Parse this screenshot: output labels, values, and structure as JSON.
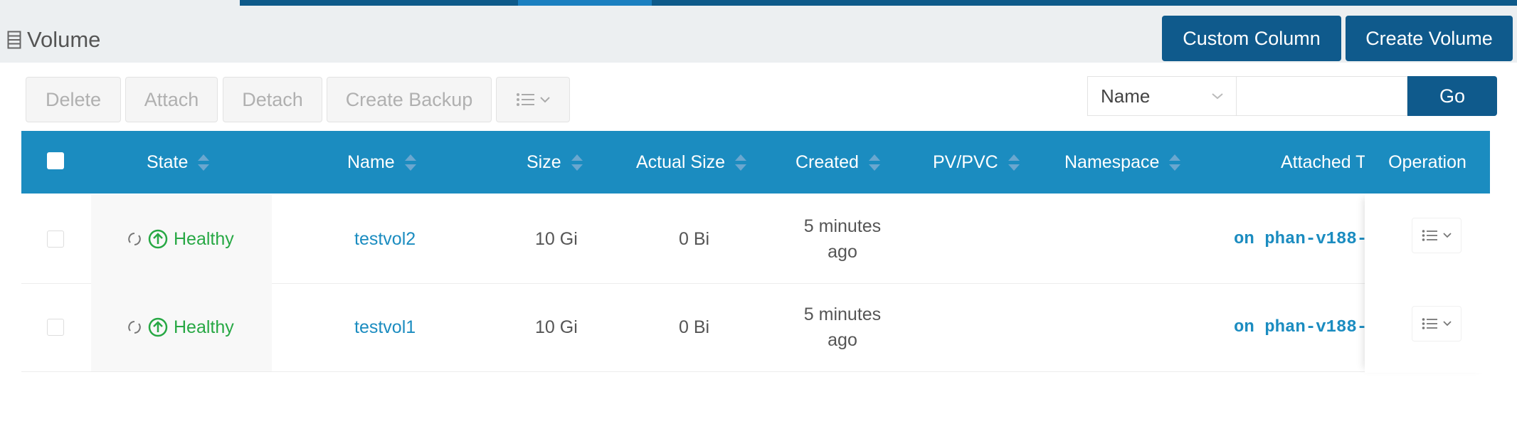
{
  "page": {
    "title": "Volume"
  },
  "header_buttons": {
    "custom_column": "Custom Column",
    "create_volume": "Create Volume"
  },
  "toolbar": {
    "delete": "Delete",
    "attach": "Attach",
    "detach": "Detach",
    "create_backup": "Create Backup",
    "more_icon": "list-icon"
  },
  "filter": {
    "field": "Name",
    "search_value": "",
    "go": "Go"
  },
  "table": {
    "columns": [
      "State",
      "Name",
      "Size",
      "Actual Size",
      "Created",
      "PV/PVC",
      "Namespace",
      "Attached T",
      "Operation"
    ],
    "rows": [
      {
        "state": "Healthy",
        "name": "testvol2",
        "size": "10 Gi",
        "actual_size": "0 Bi",
        "created_line1": "5 minutes",
        "created_line2": "ago",
        "pv_pvc": "",
        "namespace": "",
        "attached": "on phan-v188-"
      },
      {
        "state": "Healthy",
        "name": "testvol1",
        "size": "10 Gi",
        "actual_size": "0 Bi",
        "created_line1": "5 minutes",
        "created_line2": "ago",
        "pv_pvc": "",
        "namespace": "",
        "attached": "on phan-v188-"
      }
    ]
  },
  "colors": {
    "primary": "#0f5a8c",
    "header": "#1b8cc0",
    "healthy": "#27a844",
    "link": "#1b8cc0"
  }
}
